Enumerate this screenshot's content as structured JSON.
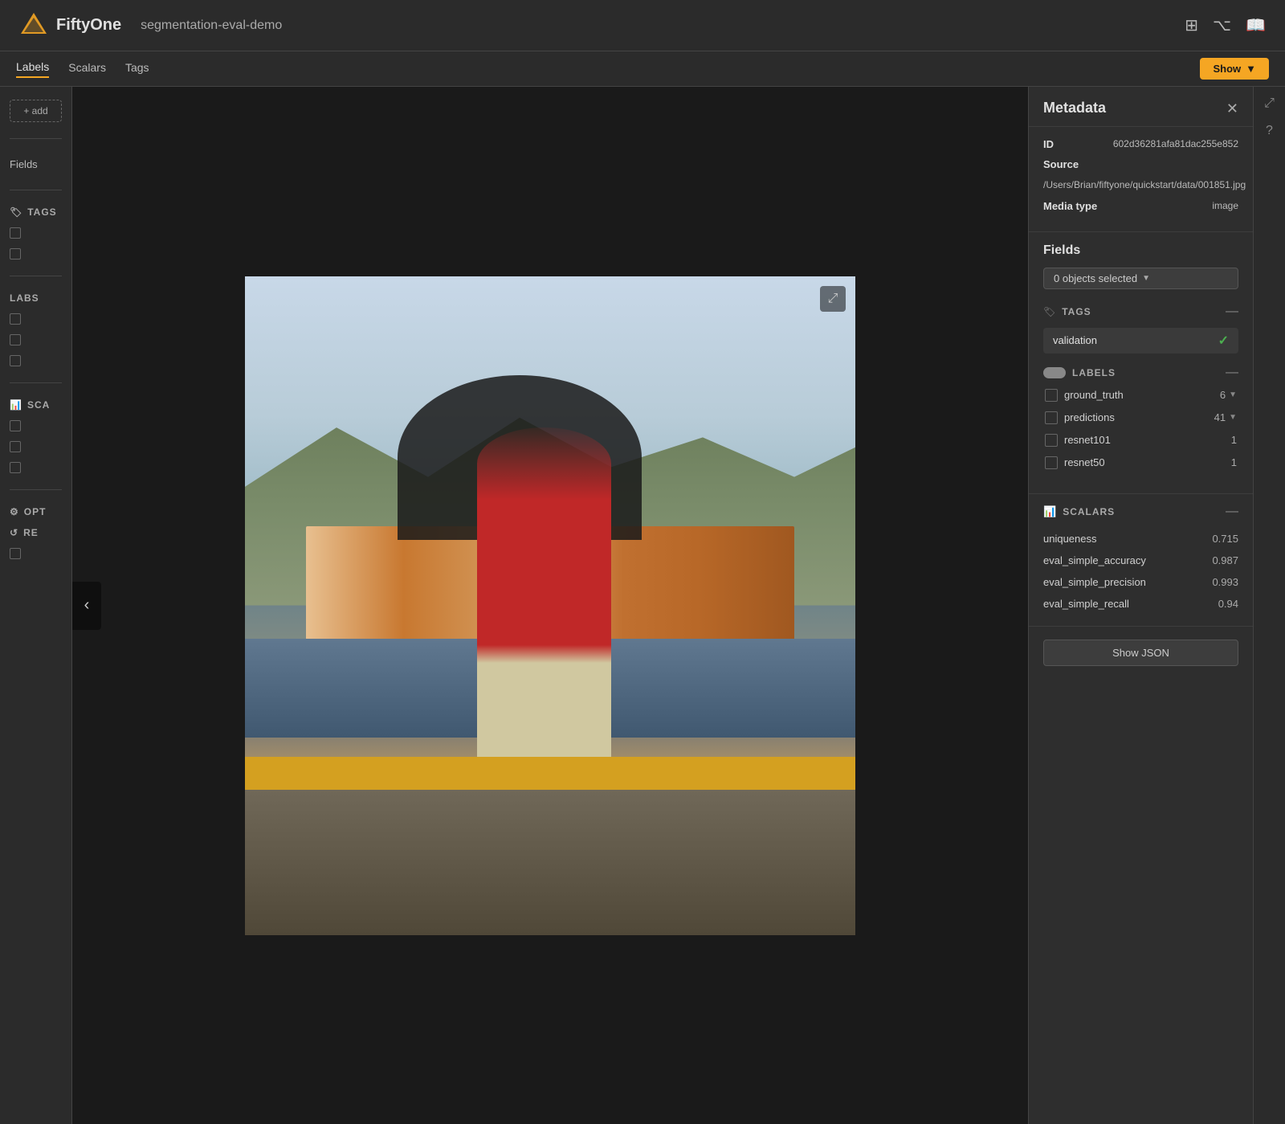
{
  "app": {
    "logo_text": "FiftyOne",
    "project_name": "segmentation-eval-demo"
  },
  "topbar": {
    "icons": [
      "grid-icon",
      "github-icon",
      "book-icon"
    ]
  },
  "tabs": {
    "items": [
      "Labels",
      "Scalars",
      "Tags"
    ],
    "show_label": "Show"
  },
  "sidebar": {
    "add_label": "+ add",
    "fields_label": "Fields",
    "tags_label": "TAGS",
    "labels_label": "LABS",
    "scalars_label": "SCA",
    "options_label": "OPT",
    "reset_label": "Re"
  },
  "metadata": {
    "title": "Metadata",
    "id_label": "ID",
    "id_value": "602d36281afa81dac255e852",
    "source_label": "Source",
    "source_value": "/Users/Brian/fiftyone/quickstart/data/001851.jpg",
    "media_type_label": "Media type",
    "media_type_value": "image",
    "fields_title": "Fields",
    "objects_selected_label": "0 objects selected",
    "tags_section": {
      "title": "TAGS",
      "tag_item": "validation",
      "tag_checked": true
    },
    "labels_section": {
      "title": "LABELS",
      "items": [
        {
          "name": "ground_truth",
          "count": "6",
          "has_arrow": true
        },
        {
          "name": "predictions",
          "count": "41",
          "has_arrow": true
        },
        {
          "name": "resnet101",
          "count": "1",
          "has_arrow": false
        },
        {
          "name": "resnet50",
          "count": "1",
          "has_arrow": false
        }
      ]
    },
    "scalars_section": {
      "title": "SCALARS",
      "items": [
        {
          "name": "uniqueness",
          "value": "0.715"
        },
        {
          "name": "eval_simple_accuracy",
          "value": "0.987"
        },
        {
          "name": "eval_simple_precision",
          "value": "0.993"
        },
        {
          "name": "eval_simple_recall",
          "value": "0.94"
        }
      ]
    },
    "show_json_label": "Show JSON",
    "close_label": "✕"
  },
  "image": {
    "expand_label": "⤢",
    "nav_prev_label": "‹"
  }
}
